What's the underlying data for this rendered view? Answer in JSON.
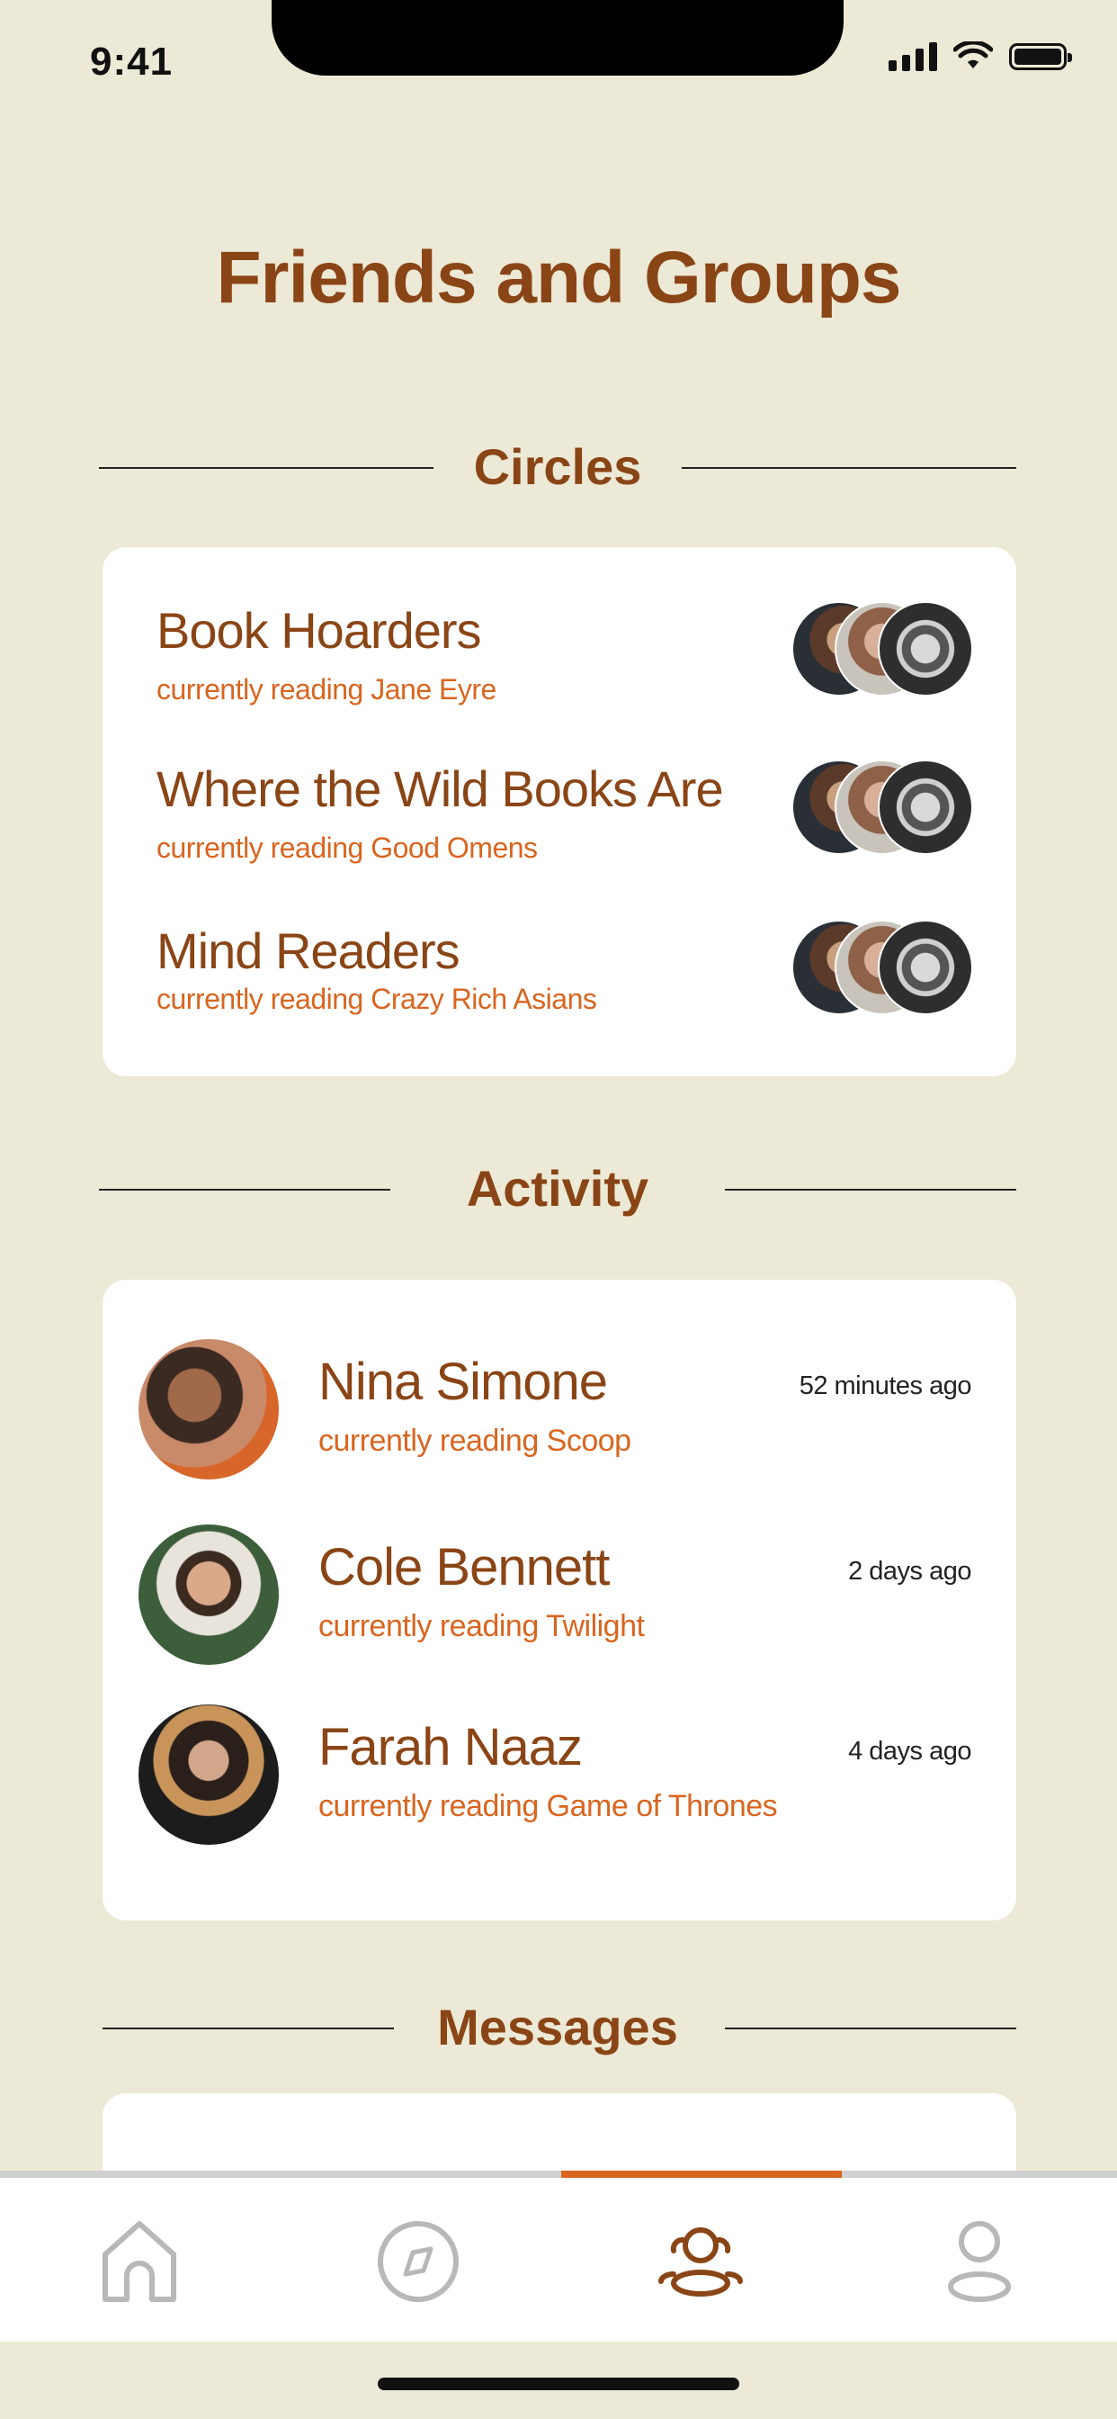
{
  "status_bar": {
    "time": "9:41"
  },
  "page_title": "Friends and Groups",
  "sections": {
    "circles": "Circles",
    "activity": "Activity",
    "messages": "Messages"
  },
  "circles": [
    {
      "name": "Book Hoarders",
      "reading": "currently reading Jane Eyre"
    },
    {
      "name": "Where the Wild Books Are",
      "reading": "currently reading Good Omens"
    },
    {
      "name": "Mind Readers",
      "reading": "currently reading Crazy Rich Asians"
    }
  ],
  "activity": [
    {
      "name": "Nina Simone",
      "reading": "currently reading Scoop",
      "time": "52 minutes ago"
    },
    {
      "name": "Cole Bennett",
      "reading": "currently reading Twilight",
      "time": "2 days ago"
    },
    {
      "name": "Farah Naaz",
      "reading": "currently reading Game of Thrones",
      "time": "4 days ago"
    }
  ],
  "tabbar": {
    "tabs": [
      "home-icon",
      "compass-icon",
      "friends-icon",
      "profile-icon"
    ],
    "active_index": 2
  },
  "colors": {
    "background": "#ECE9D6",
    "heading": "#8A4516",
    "accent": "#D9651F",
    "inactive_icon": "#B8B8B8"
  }
}
